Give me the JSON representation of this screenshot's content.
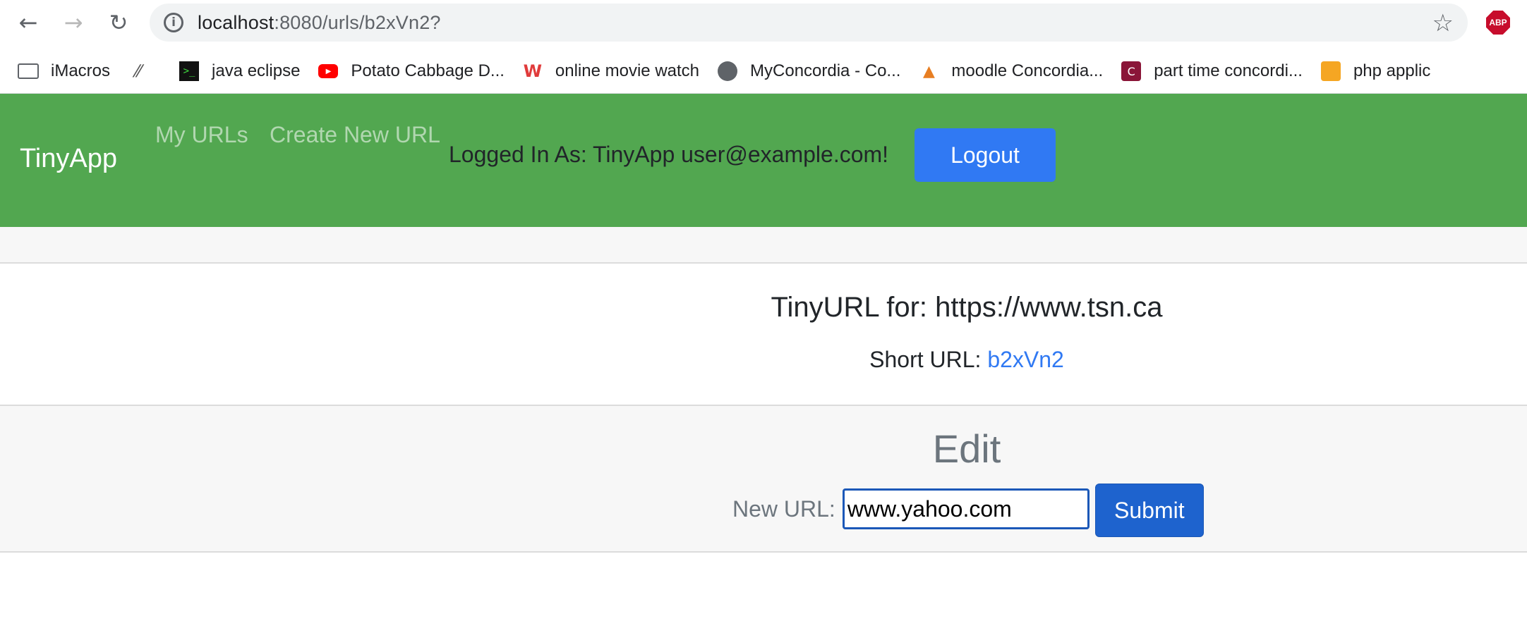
{
  "browser": {
    "url_host": "localhost",
    "url_path": ":8080/urls/b2xVn2?",
    "extension_badge": "ABP",
    "bookmarks": [
      {
        "icon": "folder-icon",
        "label": "iMacros"
      },
      {
        "icon": "devtools-icon",
        "label": ""
      },
      {
        "icon": "terminal-icon",
        "label": "java eclipse"
      },
      {
        "icon": "youtube-icon",
        "label": "Potato Cabbage D..."
      },
      {
        "icon": "w-logo-icon",
        "label": "online movie watch"
      },
      {
        "icon": "globe-icon",
        "label": "MyConcordia - Co..."
      },
      {
        "icon": "graduation-cap-icon",
        "label": "moodle Concordia..."
      },
      {
        "icon": "concordia-logo-icon",
        "label": "part time concordi..."
      },
      {
        "icon": "php-icon",
        "label": "php applic"
      }
    ]
  },
  "nav": {
    "brand": "TinyApp",
    "links": [
      "My URLs",
      "Create New URL"
    ],
    "logged_in_text": "Logged In As: TinyApp user@example.com!",
    "logout_label": "Logout",
    "bg_color": "#52a750",
    "button_color": "#3079f3"
  },
  "main": {
    "title": "TinyURL for: https://www.tsn.ca",
    "short_url_label": "Short URL:",
    "short_url_value": "b2xVn2"
  },
  "edit": {
    "heading": "Edit",
    "new_url_label": "New URL:",
    "input_value": "www.yahoo.com",
    "submit_label": "Submit"
  }
}
